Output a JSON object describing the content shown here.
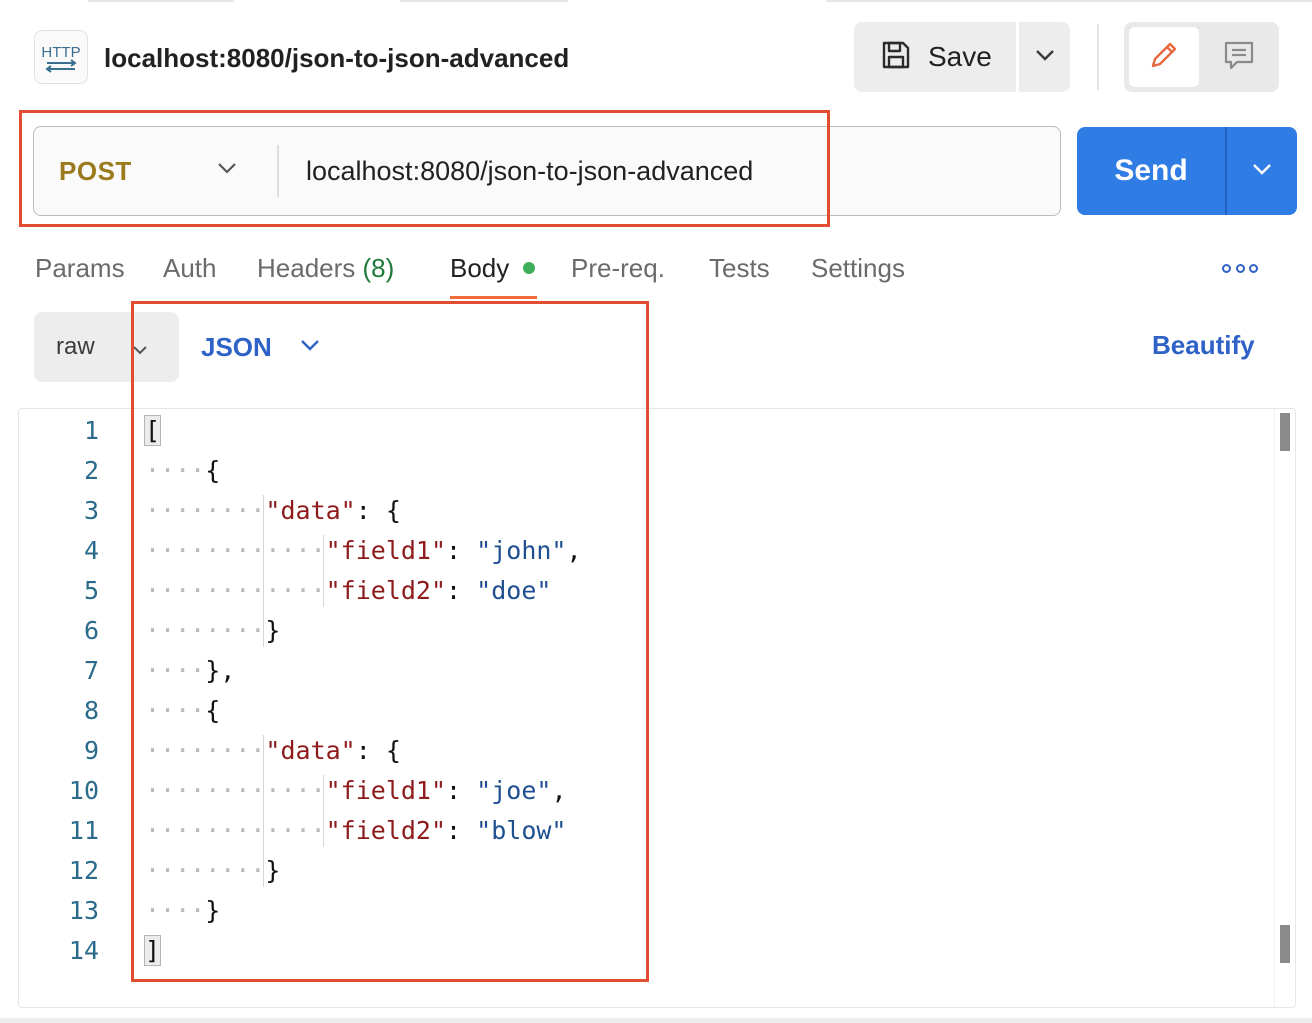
{
  "request": {
    "icon": "http-request-icon",
    "badge_text": "HTTP",
    "title": "localhost:8080/json-to-json-advanced",
    "method": "POST",
    "url": "localhost:8080/json-to-json-advanced"
  },
  "toolbar": {
    "save_label": "Save",
    "save_icon": "floppy-disk-icon",
    "save_menu_icon": "chevron-down-icon",
    "edit_icon": "pencil-icon",
    "comment_icon": "comment-icon"
  },
  "send": {
    "label": "Send",
    "menu_icon": "chevron-down-icon"
  },
  "tabs": {
    "params": "Params",
    "auth": "Auth",
    "headers": "Headers",
    "headers_count": "(8)",
    "body": "Body",
    "prereq": "Pre-req.",
    "tests": "Tests",
    "settings": "Settings",
    "more_icon": "more-horizontal-icon",
    "active": "Body"
  },
  "body_options": {
    "mode": "raw",
    "language": "JSON",
    "beautify_label": "Beautify"
  },
  "editor": {
    "line_numbers": [
      "1",
      "2",
      "3",
      "4",
      "5",
      "6",
      "7",
      "8",
      "9",
      "10",
      "11",
      "12",
      "13",
      "14"
    ],
    "content": "[\n    {\n        \"data\": {\n            \"field1\": \"john\",\n            \"field2\": \"doe\"\n        }\n    },\n    {\n        \"data\": {\n            \"field1\": \"joe\",\n            \"field2\": \"blow\"\n        }\n    }\n]"
  },
  "colors": {
    "method_post": "#9b7a1d",
    "send_button": "#2f7ce4",
    "link_blue": "#2f62c7",
    "active_tab_underline": "#f26b3a",
    "body_dot": "#3fae5a",
    "annotation_box": "#e24c30",
    "json_key": "#8e1b1b",
    "json_string": "#1f4f8f"
  }
}
